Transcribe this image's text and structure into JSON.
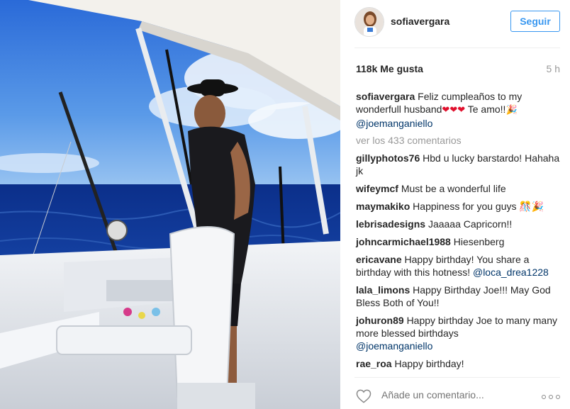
{
  "post": {
    "username": "sofiavergara",
    "follow_label": "Seguir",
    "likes": "118k Me gusta",
    "time": "5 h",
    "caption": {
      "user": "sofiavergara",
      "text1": "Feliz cumpleaños to my wonderfull husband",
      "hearts": "❤❤❤",
      "text2": " Te amo!!",
      "emoji": "🎉",
      "mention": "@joemanganiello"
    },
    "load_more": "ver los 433 comentarios",
    "comments": [
      {
        "user": "gillyphotos76",
        "text": "Hbd u lucky barstardo! Hahaha jk"
      },
      {
        "user": "wifeymcf",
        "text": "Must be a wonderful life"
      },
      {
        "user": "maymakiko",
        "text": "Happiness for you guys 🎊🎉"
      },
      {
        "user": "lebrisadesigns",
        "text": "Jaaaaa Capricorn!!"
      },
      {
        "user": "johncarmichael1988",
        "text": "Hiesenberg"
      },
      {
        "user": "ericavane",
        "text": "Happy birthday! You share a birthday with this hotness!",
        "mention": "@loca_drea1228"
      },
      {
        "user": "lala_limons",
        "text": "Happy Birthday Joe!!! May God Bless Both of You!!"
      },
      {
        "user": "johuron89",
        "text": "Happy birthday Joe to many many more blessed birthdays",
        "mention": "@joemanganiello"
      },
      {
        "user": "rae_roa",
        "text": "Happy birthday!"
      }
    ],
    "comment_placeholder": "Añade un comentario..."
  },
  "icons": {
    "like": "heart-outline-icon",
    "more": "more-options-icon"
  },
  "colors": {
    "follow_blue": "#3897f0",
    "mention": "#003569",
    "muted": "#999999"
  }
}
